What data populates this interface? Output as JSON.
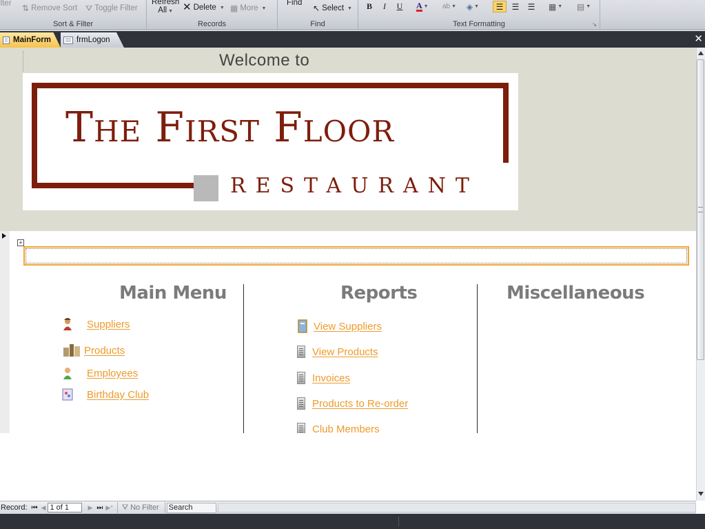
{
  "ribbon": {
    "filter_partial": "ilter",
    "remove_sort": "Remove Sort",
    "toggle_filter": "Toggle Filter",
    "sort_filter_label": "Sort & Filter",
    "refresh_line1": "Refresh",
    "refresh_line2": "All",
    "delete": "Delete",
    "more": "More",
    "records_label": "Records",
    "find": "Find",
    "select": "Select",
    "find_label": "Find",
    "bold": "B",
    "italic": "I",
    "underline": "U",
    "font_color": "A",
    "text_formatting_label": "Text Formatting"
  },
  "tabs": [
    {
      "label": "MainForm"
    },
    {
      "label": "frmLogon"
    }
  ],
  "form": {
    "welcome": "Welcome to",
    "logo_line1": "The First Floor",
    "logo_line2": "RESTAURANT",
    "sections": {
      "main_menu": "Main Menu",
      "reports": "Reports",
      "misc": "Miscellaneous"
    },
    "main_links": [
      "Suppliers",
      "Products",
      "Employees",
      "Birthday Club"
    ],
    "report_links": [
      "View Suppliers",
      "View Products",
      "Invoices",
      "Products to Re-order",
      "Club Members"
    ]
  },
  "navbar": {
    "record_label": "Record:",
    "record_value": "1 of 1",
    "no_filter": "No Filter",
    "search_placeholder": "Search"
  },
  "colors": {
    "link": "#ee9a2a",
    "logo": "#7d1e0d",
    "section_title": "#7b7b7b",
    "header_band": "#dcdcd0"
  }
}
